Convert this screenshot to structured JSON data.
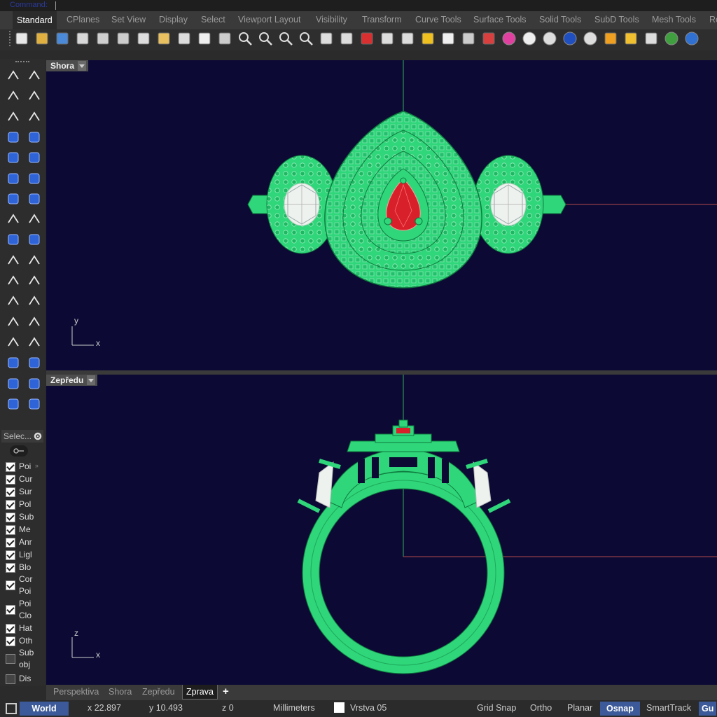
{
  "command": {
    "label": "Command:"
  },
  "tabs": [
    "Standard",
    "CPlanes",
    "Set View",
    "Display",
    "Select",
    "Viewport Layout",
    "Visibility",
    "Transform",
    "Curve Tools",
    "Surface Tools",
    "Solid Tools",
    "SubD Tools",
    "Mesh Tools",
    "Re"
  ],
  "active_tab": "Standard",
  "toolbar_icons": [
    "new-file-icon",
    "open-folder-icon",
    "save-icon",
    "print-icon",
    "import-icon",
    "cut-icon",
    "copy-icon",
    "paste-icon",
    "undo-icon",
    "pan-hand-icon",
    "rotate-view-icon",
    "zoom-icon",
    "zoom-window-icon",
    "zoom-extents-icon",
    "zoom-selected-icon",
    "rotate-3d-icon",
    "four-viewports-icon",
    "car-icon",
    "grid-options-icon",
    "cplane-icon",
    "point-snap-icon",
    "light-bulb-icon",
    "lock-icon",
    "layer-icon",
    "color-wheel-icon",
    "render-sphere-icon",
    "wireframe-sphere-icon",
    "shaded-sphere-icon",
    "glossy-sphere-icon",
    "light-cone-icon",
    "settings-gear-icon",
    "options-grid-icon",
    "rhino-globe-icon",
    "help-icon"
  ],
  "viewport_top": {
    "title": "Shora",
    "axis_v": "y",
    "axis_h": "x"
  },
  "viewport_bottom": {
    "title": "Zepředu",
    "axis_v": "z",
    "axis_h": "x"
  },
  "panel": {
    "select_label": "Selec...",
    "layers": [
      {
        "label": "Poi",
        "checked": true
      },
      {
        "label": "Cur",
        "checked": true
      },
      {
        "label": "Sur",
        "checked": true
      },
      {
        "label": "Pol",
        "checked": true
      },
      {
        "label": "Sub",
        "checked": true
      },
      {
        "label": "Me",
        "checked": true
      },
      {
        "label": "Anr",
        "checked": true
      },
      {
        "label": "Ligl",
        "checked": true
      },
      {
        "label": "Blo",
        "checked": true
      },
      {
        "label": "Cor Poi",
        "checked": true
      },
      {
        "label": "Poi Clo",
        "checked": true
      },
      {
        "label": "Hat",
        "checked": true
      },
      {
        "label": "Oth",
        "checked": true
      },
      {
        "label": "Sub obj",
        "checked": false
      },
      {
        "label": "Dis",
        "checked": false
      }
    ]
  },
  "viewport_tabs": [
    "Perspektiva",
    "Shora",
    "Zepředu",
    "Zprava"
  ],
  "active_viewport_tab": "Zprava",
  "status": {
    "cplane": "World",
    "x": "x 22.897",
    "y": "y 10.493",
    "z": "z 0",
    "units": "Millimeters",
    "layer": "Vrstva 05",
    "grid_snap": "Grid Snap",
    "ortho": "Ortho",
    "planar": "Planar",
    "osnap": "Osnap",
    "smarttrack": "SmartTrack",
    "gumball": "Gu"
  },
  "colors": {
    "viewport_bg": "#0c0a34",
    "model_green": "#2fd67a",
    "gem_red": "#d8202a",
    "status_active": "#3c5a99"
  }
}
